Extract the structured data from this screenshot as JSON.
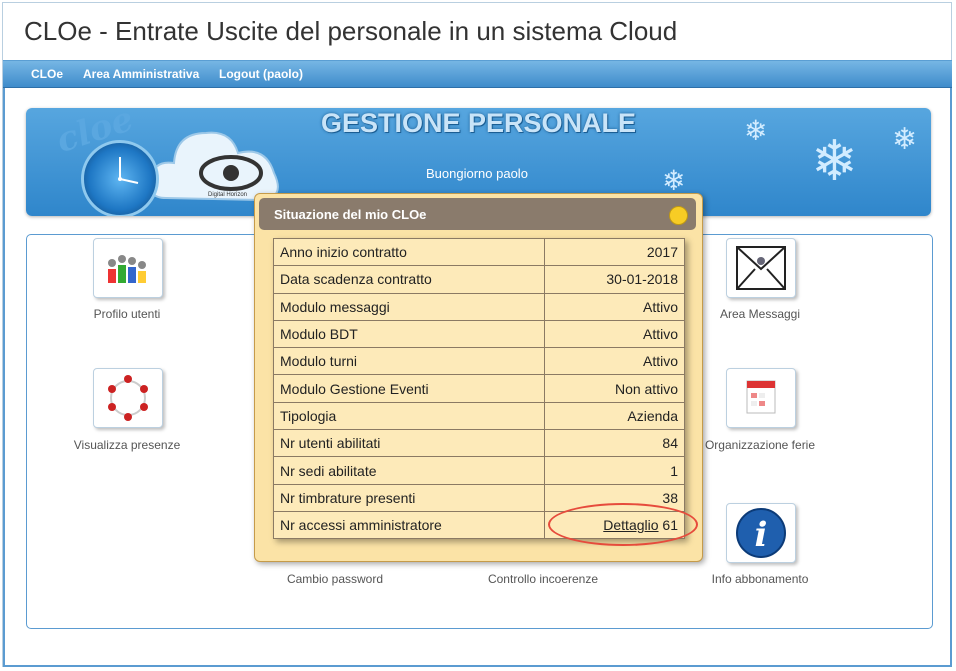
{
  "app_title": "CLOe - Entrate Uscite del personale in un sistema Cloud",
  "nav": {
    "items": [
      "CLOe",
      "Area Amministrativa",
      "Logout (paolo)"
    ]
  },
  "banner": {
    "title": "GESTIONE PERSONALE",
    "greeting": "Buongiorno paolo",
    "logo_text": "cloe",
    "clock_text": "Digital Horizon"
  },
  "tiles": {
    "profilo": "Profilo utenti",
    "presenze": "Visualizza presenze",
    "messaggi": "Area Messaggi",
    "ferie": "Organizzazione ferie",
    "password": "Cambio password",
    "incoerenze": "Controllo incoerenze",
    "abbonamento": "Info abbonamento"
  },
  "modal": {
    "title": "Situazione del mio CLOe",
    "rows": [
      {
        "label": "Anno inizio contratto",
        "value": "2017"
      },
      {
        "label": "Data scadenza contratto",
        "value": "30-01-2018"
      },
      {
        "label": "Modulo messaggi",
        "value": "Attivo"
      },
      {
        "label": "Modulo BDT",
        "value": "Attivo"
      },
      {
        "label": "Modulo turni",
        "value": "Attivo"
      },
      {
        "label": "Modulo Gestione Eventi",
        "value": "Non attivo"
      },
      {
        "label": "Tipologia",
        "value": "Azienda"
      },
      {
        "label": "Nr utenti abilitati",
        "value": "84"
      },
      {
        "label": "Nr sedi abilitate",
        "value": "1"
      },
      {
        "label": "Nr timbrature presenti",
        "value": "38"
      },
      {
        "label": "Nr accessi amministratore",
        "link": "Dettaglio",
        "value": "61"
      }
    ]
  },
  "colors": {
    "nav_bar": "#4a97d2",
    "modal_bg": "#fbe3a6",
    "modal_header": "#8a7b6c",
    "highlight": "#e64b3c"
  }
}
